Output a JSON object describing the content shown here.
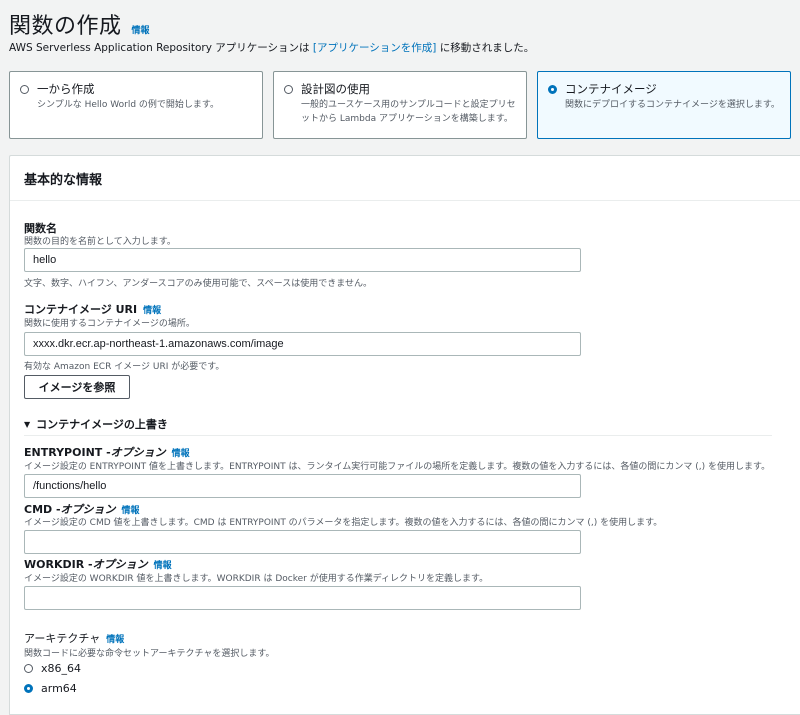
{
  "header": {
    "title": "関数の作成",
    "info_label": "情報",
    "subtitle_prefix": "AWS Serverless Application Repository アプリケーションは ",
    "subtitle_link": "[アプリケーションを作成]",
    "subtitle_suffix": " に移動されました。"
  },
  "options": [
    {
      "label": "一から作成",
      "description": "シンプルな Hello World の例で開始します。",
      "selected": false
    },
    {
      "label": "設計図の使用",
      "description": "一般的ユースケース用のサンプルコードと設定プリセットから Lambda アプリケーションを構築します。",
      "selected": false
    },
    {
      "label": "コンテナイメージ",
      "description": "関数にデプロイするコンテナイメージを選択します。",
      "selected": true
    }
  ],
  "basic_info": {
    "heading": "基本的な情報",
    "function_name": {
      "label": "関数名",
      "description": "関数の目的を名前として入力します。",
      "value": "hello",
      "constraint": "文字、数字、ハイフン、アンダースコアのみ使用可能で、スペースは使用できません。"
    },
    "image_uri": {
      "label": "コンテナイメージ URI",
      "info_label": "情報",
      "description": "関数に使用するコンテナイメージの場所。",
      "value": "xxxx.dkr.ecr.ap-northeast-1.amazonaws.com/image",
      "constraint": "有効な Amazon ECR イメージ URI が必要です。",
      "browse_button": "イメージを参照"
    },
    "overrides": {
      "toggle_label": "コンテナイメージの上書き",
      "expanded": true,
      "entrypoint": {
        "label_name": "ENTRYPOINT - ",
        "label_optional": "オプション",
        "info_label": "情報",
        "description": "イメージ設定の ENTRYPOINT 値を上書きします。ENTRYPOINT は、ランタイム実行可能ファイルの場所を定義します。複数の値を入力するには、各値の間にカンマ (,) を使用します。",
        "value": "/functions/hello"
      },
      "cmd": {
        "label_name": "CMD - ",
        "label_optional": "オプション",
        "info_label": "情報",
        "description": "イメージ設定の CMD 値を上書きします。CMD は ENTRYPOINT のパラメータを指定します。複数の値を入力するには、各値の間にカンマ (,) を使用します。",
        "value": ""
      },
      "workdir": {
        "label_name": "WORKDIR - ",
        "label_optional": "オプション",
        "info_label": "情報",
        "description": "イメージ設定の WORKDIR 値を上書きします。WORKDIR は Docker が使用する作業ディレクトリを定義します。",
        "value": ""
      }
    },
    "architecture": {
      "label": "アーキテクチャ",
      "info_label": "情報",
      "description": "関数コードに必要な命令セットアーキテクチャを選択します。",
      "options": [
        {
          "label": "x86_64",
          "selected": false
        },
        {
          "label": "arm64",
          "selected": true
        }
      ]
    }
  },
  "colors": {
    "accent": "#0073bb",
    "background": "#f2f3f3",
    "text": "#16191f",
    "secondary_text": "#545b64"
  }
}
